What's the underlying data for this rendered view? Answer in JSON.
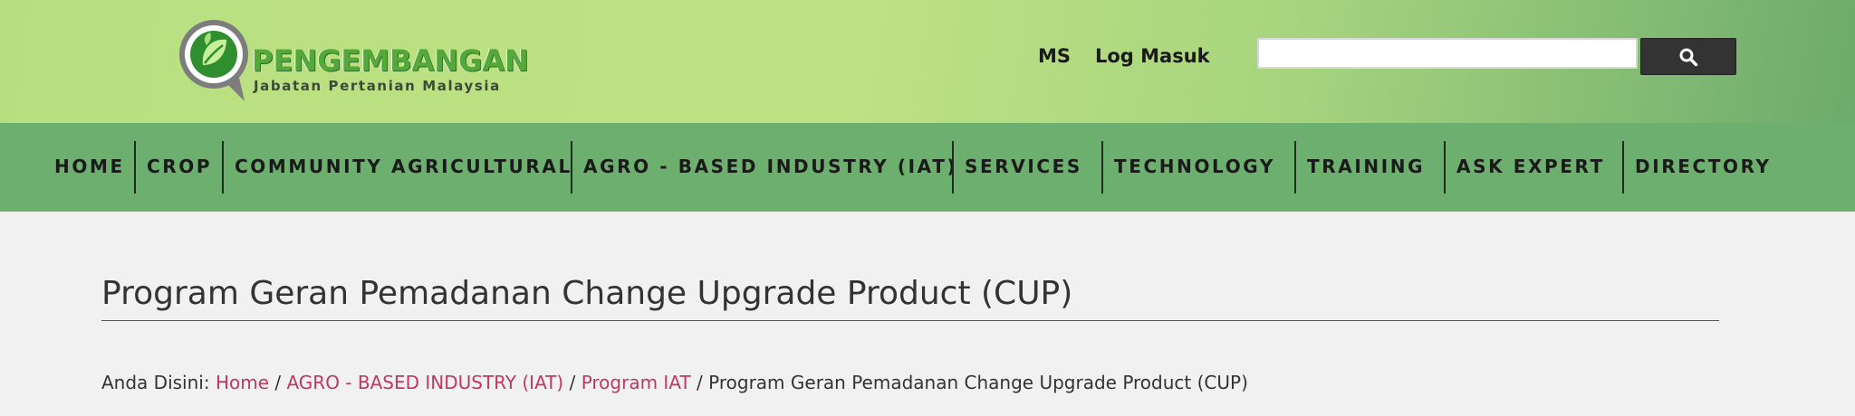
{
  "header": {
    "logo": {
      "title": "PENGEMBANGAN",
      "subtitle": "Jabatan Pertanian Malaysia"
    },
    "top_links": {
      "language": "MS",
      "login": "Log Masuk"
    },
    "search": {
      "value": "",
      "placeholder": "",
      "button_icon": "search-icon"
    }
  },
  "nav": {
    "items": [
      {
        "label": "HOME"
      },
      {
        "label": "CROP"
      },
      {
        "label": "COMMUNITY AGRICULTURAL"
      },
      {
        "label": "AGRO - BASED INDUSTRY (IAT)"
      },
      {
        "label": "SERVICES"
      },
      {
        "label": "TECHNOLOGY"
      },
      {
        "label": "TRAINING"
      },
      {
        "label": "ASK EXPERT"
      },
      {
        "label": "DIRECTORY"
      }
    ]
  },
  "main": {
    "title": "Program Geran Pemadanan Change Upgrade Product (CUP)",
    "breadcrumb": {
      "prefix": "Anda Disini:",
      "links": [
        "Home",
        "AGRO - BASED INDUSTRY (IAT)",
        "Program IAT"
      ],
      "separator": "/",
      "current": "Program Geran Pemadanan Change Upgrade Product (CUP)"
    }
  },
  "colors": {
    "header_green": "#bfe284",
    "nav_green": "#6daf6e",
    "link_pink": "#c0385e",
    "background": "#f1f1f1"
  }
}
